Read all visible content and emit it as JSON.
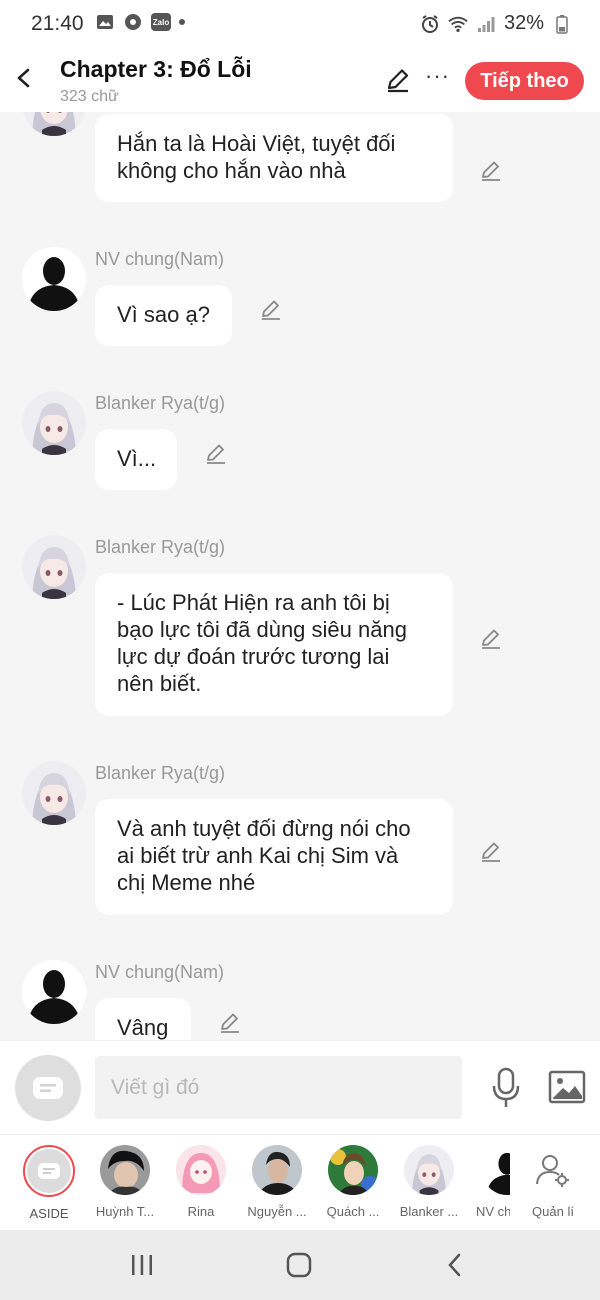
{
  "status_bar": {
    "time": "21:40",
    "battery": "32%",
    "zalo_label": "Zalo"
  },
  "header": {
    "title": "Chapter 3: Đổ Lỗi",
    "subtitle": "323 chữ",
    "next_label": "Tiếp theo",
    "more_label": "···"
  },
  "messages": [
    {
      "sender": "",
      "text": "Hắn ta là Hoài Việt, tuyệt đối\nkhông cho hắn vào nhà",
      "avatar": "anime-girl"
    },
    {
      "sender": "NV chung(Nam)",
      "text": "Vì sao ạ?",
      "avatar": "silhouette"
    },
    {
      "sender": "Blanker Rya(t/g)",
      "text": "Vì...",
      "avatar": "anime-girl"
    },
    {
      "sender": "Blanker Rya(t/g)",
      "text": "- Lúc Phát Hiện ra anh tôi bị\nbạo lực tôi đã dùng siêu năng\nlực dự đoán trước tương lai\nnên biết.",
      "avatar": "anime-girl"
    },
    {
      "sender": "Blanker Rya(t/g)",
      "text": "Và anh tuyệt đối đừng nói cho\nai biết trừ anh Kai chị Sim và\nchị Meme nhé",
      "avatar": "anime-girl"
    },
    {
      "sender": "NV chung(Nam)",
      "text": "Vâng",
      "avatar": "silhouette"
    }
  ],
  "input": {
    "placeholder": "Viết gì đó"
  },
  "characters": [
    {
      "name": "ASIDE",
      "avatar": "aside"
    },
    {
      "name": "Huỳnh T...",
      "avatar": "boy-dark-hair"
    },
    {
      "name": "Rina",
      "avatar": "pink-hair-girl"
    },
    {
      "name": "Nguyễn ...",
      "avatar": "man-dark"
    },
    {
      "name": "Quách ...",
      "avatar": "boy-colorful"
    },
    {
      "name": "Blanker ...",
      "avatar": "anime-girl"
    },
    {
      "name": "NV ch",
      "avatar": "silhouette"
    },
    {
      "name": "Quản lí",
      "avatar": "manage-icon"
    }
  ],
  "colors": {
    "accent": "#f0484f",
    "background": "#f5f5f5",
    "bubble": "#ffffff",
    "sender_text": "#999999"
  }
}
